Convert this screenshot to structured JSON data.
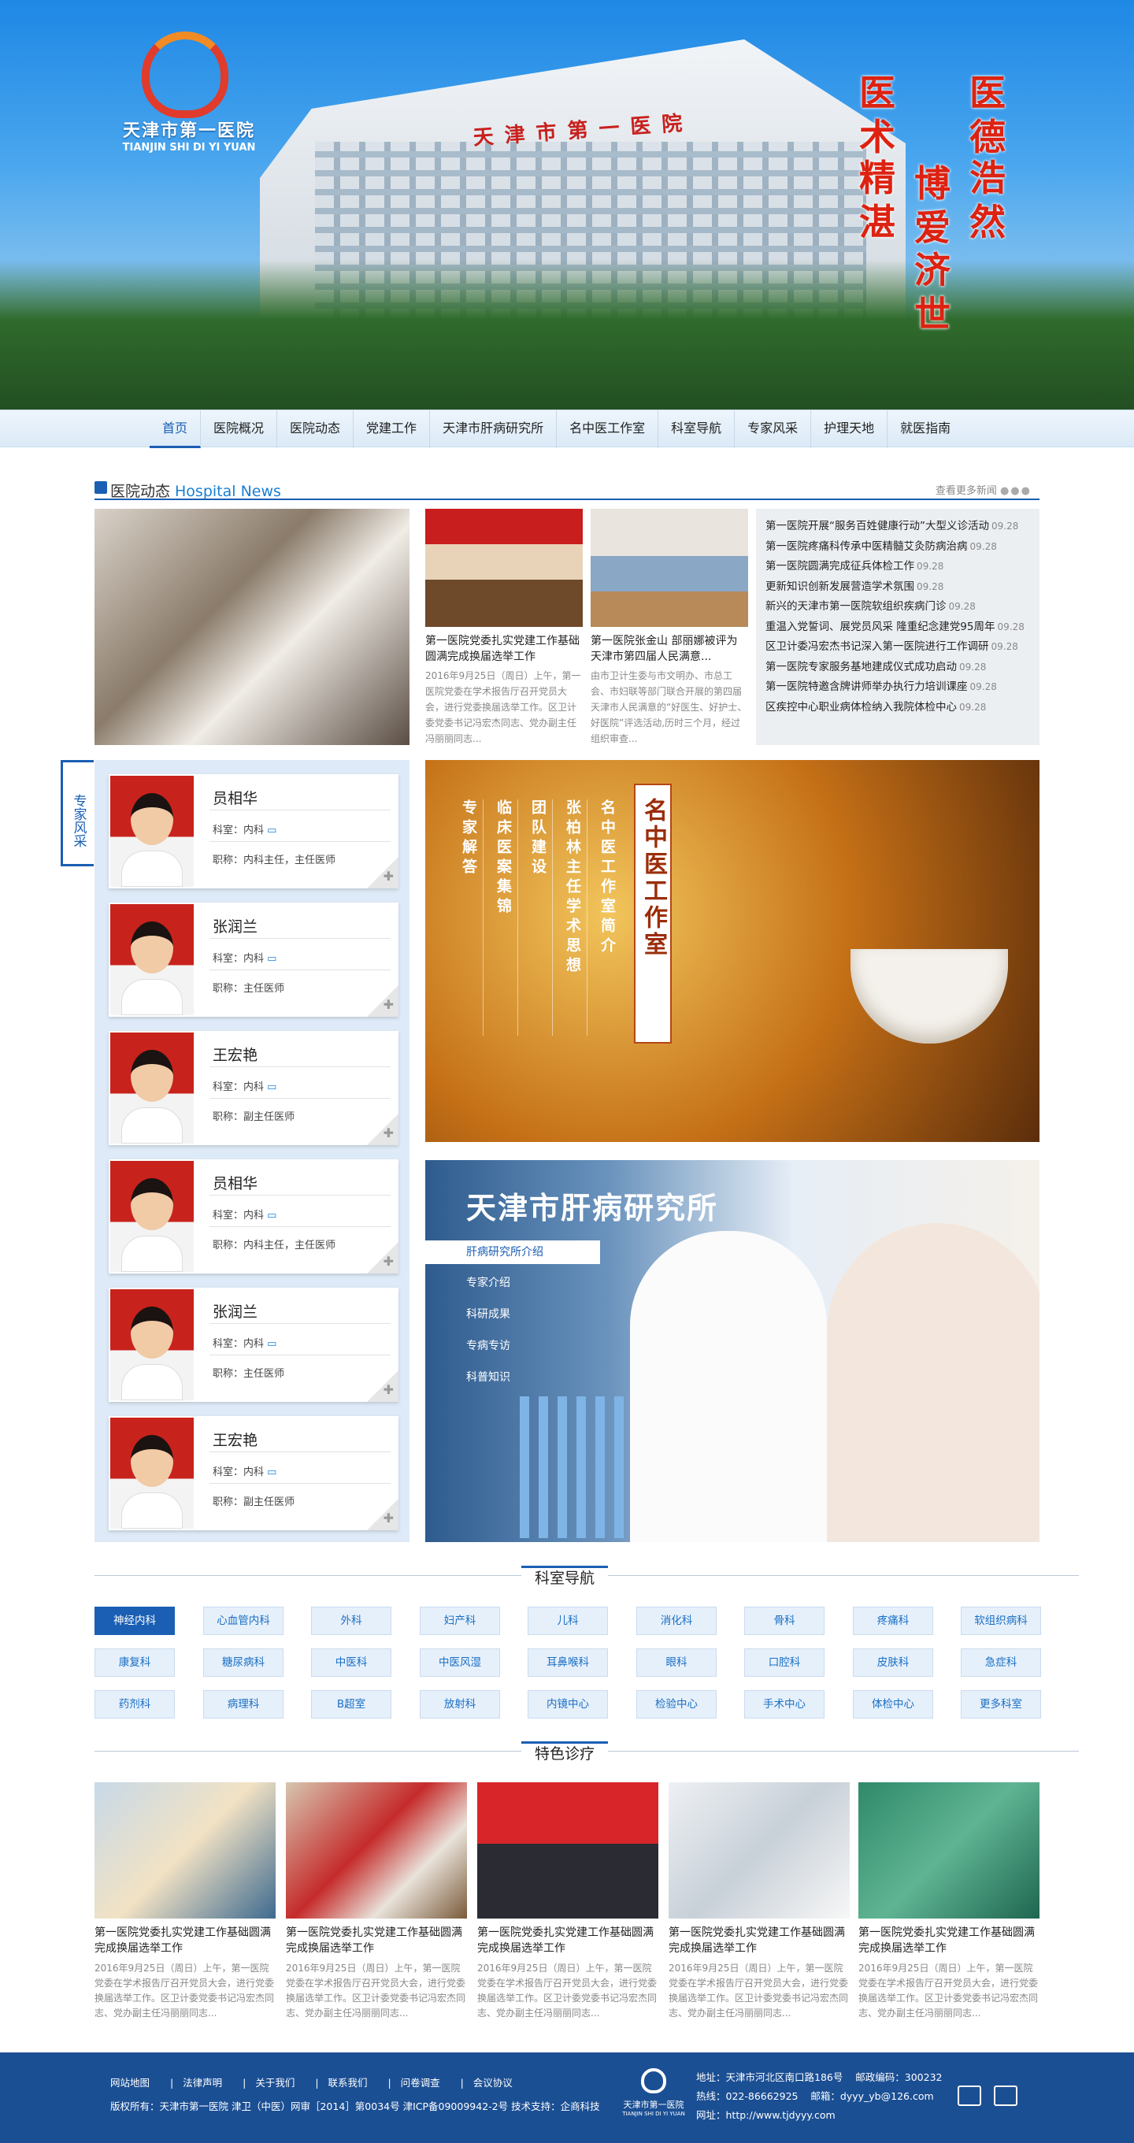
{
  "banner": {
    "logo_cn": "天津市第一医院",
    "logo_en": "TIANJIN SHI DI YI YUAN",
    "building_sign": "天津市第一医院",
    "motto": [
      "医德",
      "浩然",
      "医术",
      "精湛",
      "博爱",
      "济世"
    ]
  },
  "nav": {
    "items": [
      "首页",
      "医院概况",
      "医院动态",
      "党建工作",
      "天津市肝病研究所",
      "名中医工作室",
      "科室导航",
      "专家风采",
      "护理天地",
      "就医指南"
    ],
    "active": "首页"
  },
  "news": {
    "title_cn": "医院动态",
    "title_en": "Hospital News",
    "more": "查看更多新闻",
    "cards": [
      {
        "title": "第一医院党委扎实党建工作基础圆满完成换届选举工作",
        "desc": "2016年9月25日（周日）上午，第一医院党委在学术报告厅召开党员大会，进行党委换届选举工作。区卫计委党委书记冯宏杰同志、党办副主任冯丽丽同志..."
      },
      {
        "title": "第一医院张金山 部丽娜被评为天津市第四届人民满意...",
        "desc": "由市卫计生委与市文明办、市总工会、市妇联等部门联合开展的第四届天津市人民满意的“好医生、好护士、好医院”评选活动,历时三个月，经过组织审查..."
      }
    ],
    "list": [
      {
        "t": "第一医院开展“服务百姓健康行动”大型义诊活动",
        "d": "09.28"
      },
      {
        "t": "第一医院疼痛科传承中医精髓艾灸防病治病",
        "d": "09.28"
      },
      {
        "t": "第一医院圆满完成征兵体检工作",
        "d": "09.28"
      },
      {
        "t": "更新知识创新发展营造学术氛围",
        "d": "09.28"
      },
      {
        "t": "新兴的天津市第一医院软组织疾病门诊",
        "d": "09.28"
      },
      {
        "t": "重温入党誓词、展党员风采 隆重纪念建党95周年",
        "d": "09.28"
      },
      {
        "t": "区卫计委冯宏杰书记深入第一医院进行工作调研",
        "d": "09.28"
      },
      {
        "t": "第一医院专家服务基地建成仪式成功启动",
        "d": "09.28"
      },
      {
        "t": "第一医院特邀含牌讲师举办执行力培训课座",
        "d": "09.28"
      },
      {
        "t": "区疾控中心职业病体检纳入我院体检中心",
        "d": "09.28"
      }
    ]
  },
  "experts": {
    "tab_label": "专家风采",
    "dept_prefix": "科室：",
    "role_prefix": "职称：",
    "doctors": [
      {
        "name": "员相华",
        "dept": "内科",
        "role": "内科主任，主任医师"
      },
      {
        "name": "张润兰",
        "dept": "内科",
        "role": "主任医师"
      },
      {
        "name": "王宏艳",
        "dept": "内科",
        "role": "副主任医师"
      },
      {
        "name": "员相华",
        "dept": "内科",
        "role": "内科主任，主任医师"
      },
      {
        "name": "张润兰",
        "dept": "内科",
        "role": "主任医师"
      },
      {
        "name": "王宏艳",
        "dept": "内科",
        "role": "副主任医师"
      }
    ]
  },
  "tcm": {
    "title": "名中医工作室",
    "columns": [
      "名中医工作室简介",
      "张柏林主任学术思想",
      "团队建设",
      "临床医案集锦",
      "专家解答"
    ]
  },
  "liver": {
    "title": "天津市肝病研究所",
    "active": "肝病研究所介绍",
    "links": [
      "专家介绍",
      "科研成果",
      "专病专访",
      "科普知识"
    ]
  },
  "depts": {
    "title": "科室导航",
    "items": [
      "神经内科",
      "心血管内科",
      "外科",
      "妇产科",
      "儿科",
      "消化科",
      "骨科",
      "疼痛科",
      "软组织病科",
      "康复科",
      "糖尿病科",
      "中医科",
      "中医风湿",
      "耳鼻喉科",
      "眼科",
      "口腔科",
      "皮肤科",
      "急症科",
      "药剂科",
      "病理科",
      "B超室",
      "放射科",
      "内镜中心",
      "检验中心",
      "手术中心",
      "体检中心",
      "更多科室"
    ]
  },
  "features": {
    "title": "特色诊疗",
    "items": [
      {
        "title": "第一医院党委扎实党建工作基础圆满完成换届选举工作",
        "desc": "2016年9月25日（周日）上午，第一医院党委在学术报告厅召开党员大会，进行党委换届选举工作。区卫计委党委书记冯宏杰同志、党办副主任冯丽丽同志..."
      },
      {
        "title": "第一医院党委扎实党建工作基础圆满完成换届选举工作",
        "desc": "2016年9月25日（周日）上午，第一医院党委在学术报告厅召开党员大会，进行党委换届选举工作。区卫计委党委书记冯宏杰同志、党办副主任冯丽丽同志..."
      },
      {
        "title": "第一医院党委扎实党建工作基础圆满完成换届选举工作",
        "desc": "2016年9月25日（周日）上午，第一医院党委在学术报告厅召开党员大会，进行党委换届选举工作。区卫计委党委书记冯宏杰同志、党办副主任冯丽丽同志..."
      },
      {
        "title": "第一医院党委扎实党建工作基础圆满完成换届选举工作",
        "desc": "2016年9月25日（周日）上午，第一医院党委在学术报告厅召开党员大会，进行党委换届选举工作。区卫计委党委书记冯宏杰同志、党办副主任冯丽丽同志..."
      },
      {
        "title": "第一医院党委扎实党建工作基础圆满完成换届选举工作",
        "desc": "2016年9月25日（周日）上午，第一医院党委在学术报告厅召开党员大会，进行党委换届选举工作。区卫计委党委书记冯宏杰同志、党办副主任冯丽丽同志..."
      }
    ]
  },
  "footer": {
    "links": [
      "网站地图",
      "法律声明",
      "关于我们",
      "联系我们",
      "问卷调查",
      "会议协议"
    ],
    "copyright": "版权所有：天津市第一医院 津卫（中医）网审［2014］第0034号  津ICP备09009942-2号  技术支持：企商科技",
    "logo_cn": "天津市第一医院",
    "logo_en": "TIANJIN SHI DI YI YUAN",
    "address": "地址：天津市河北区南口路186号",
    "postcode": "邮政编码：300232",
    "hotline": "热线：022-86662925",
    "email": "邮箱：dyyy_yb@126.com",
    "website": "网址：http://www.tjdyyy.com"
  },
  "colors": {
    "primary": "#1a5fb4",
    "footer": "#1b4f94",
    "accent": "#d21f1f"
  }
}
